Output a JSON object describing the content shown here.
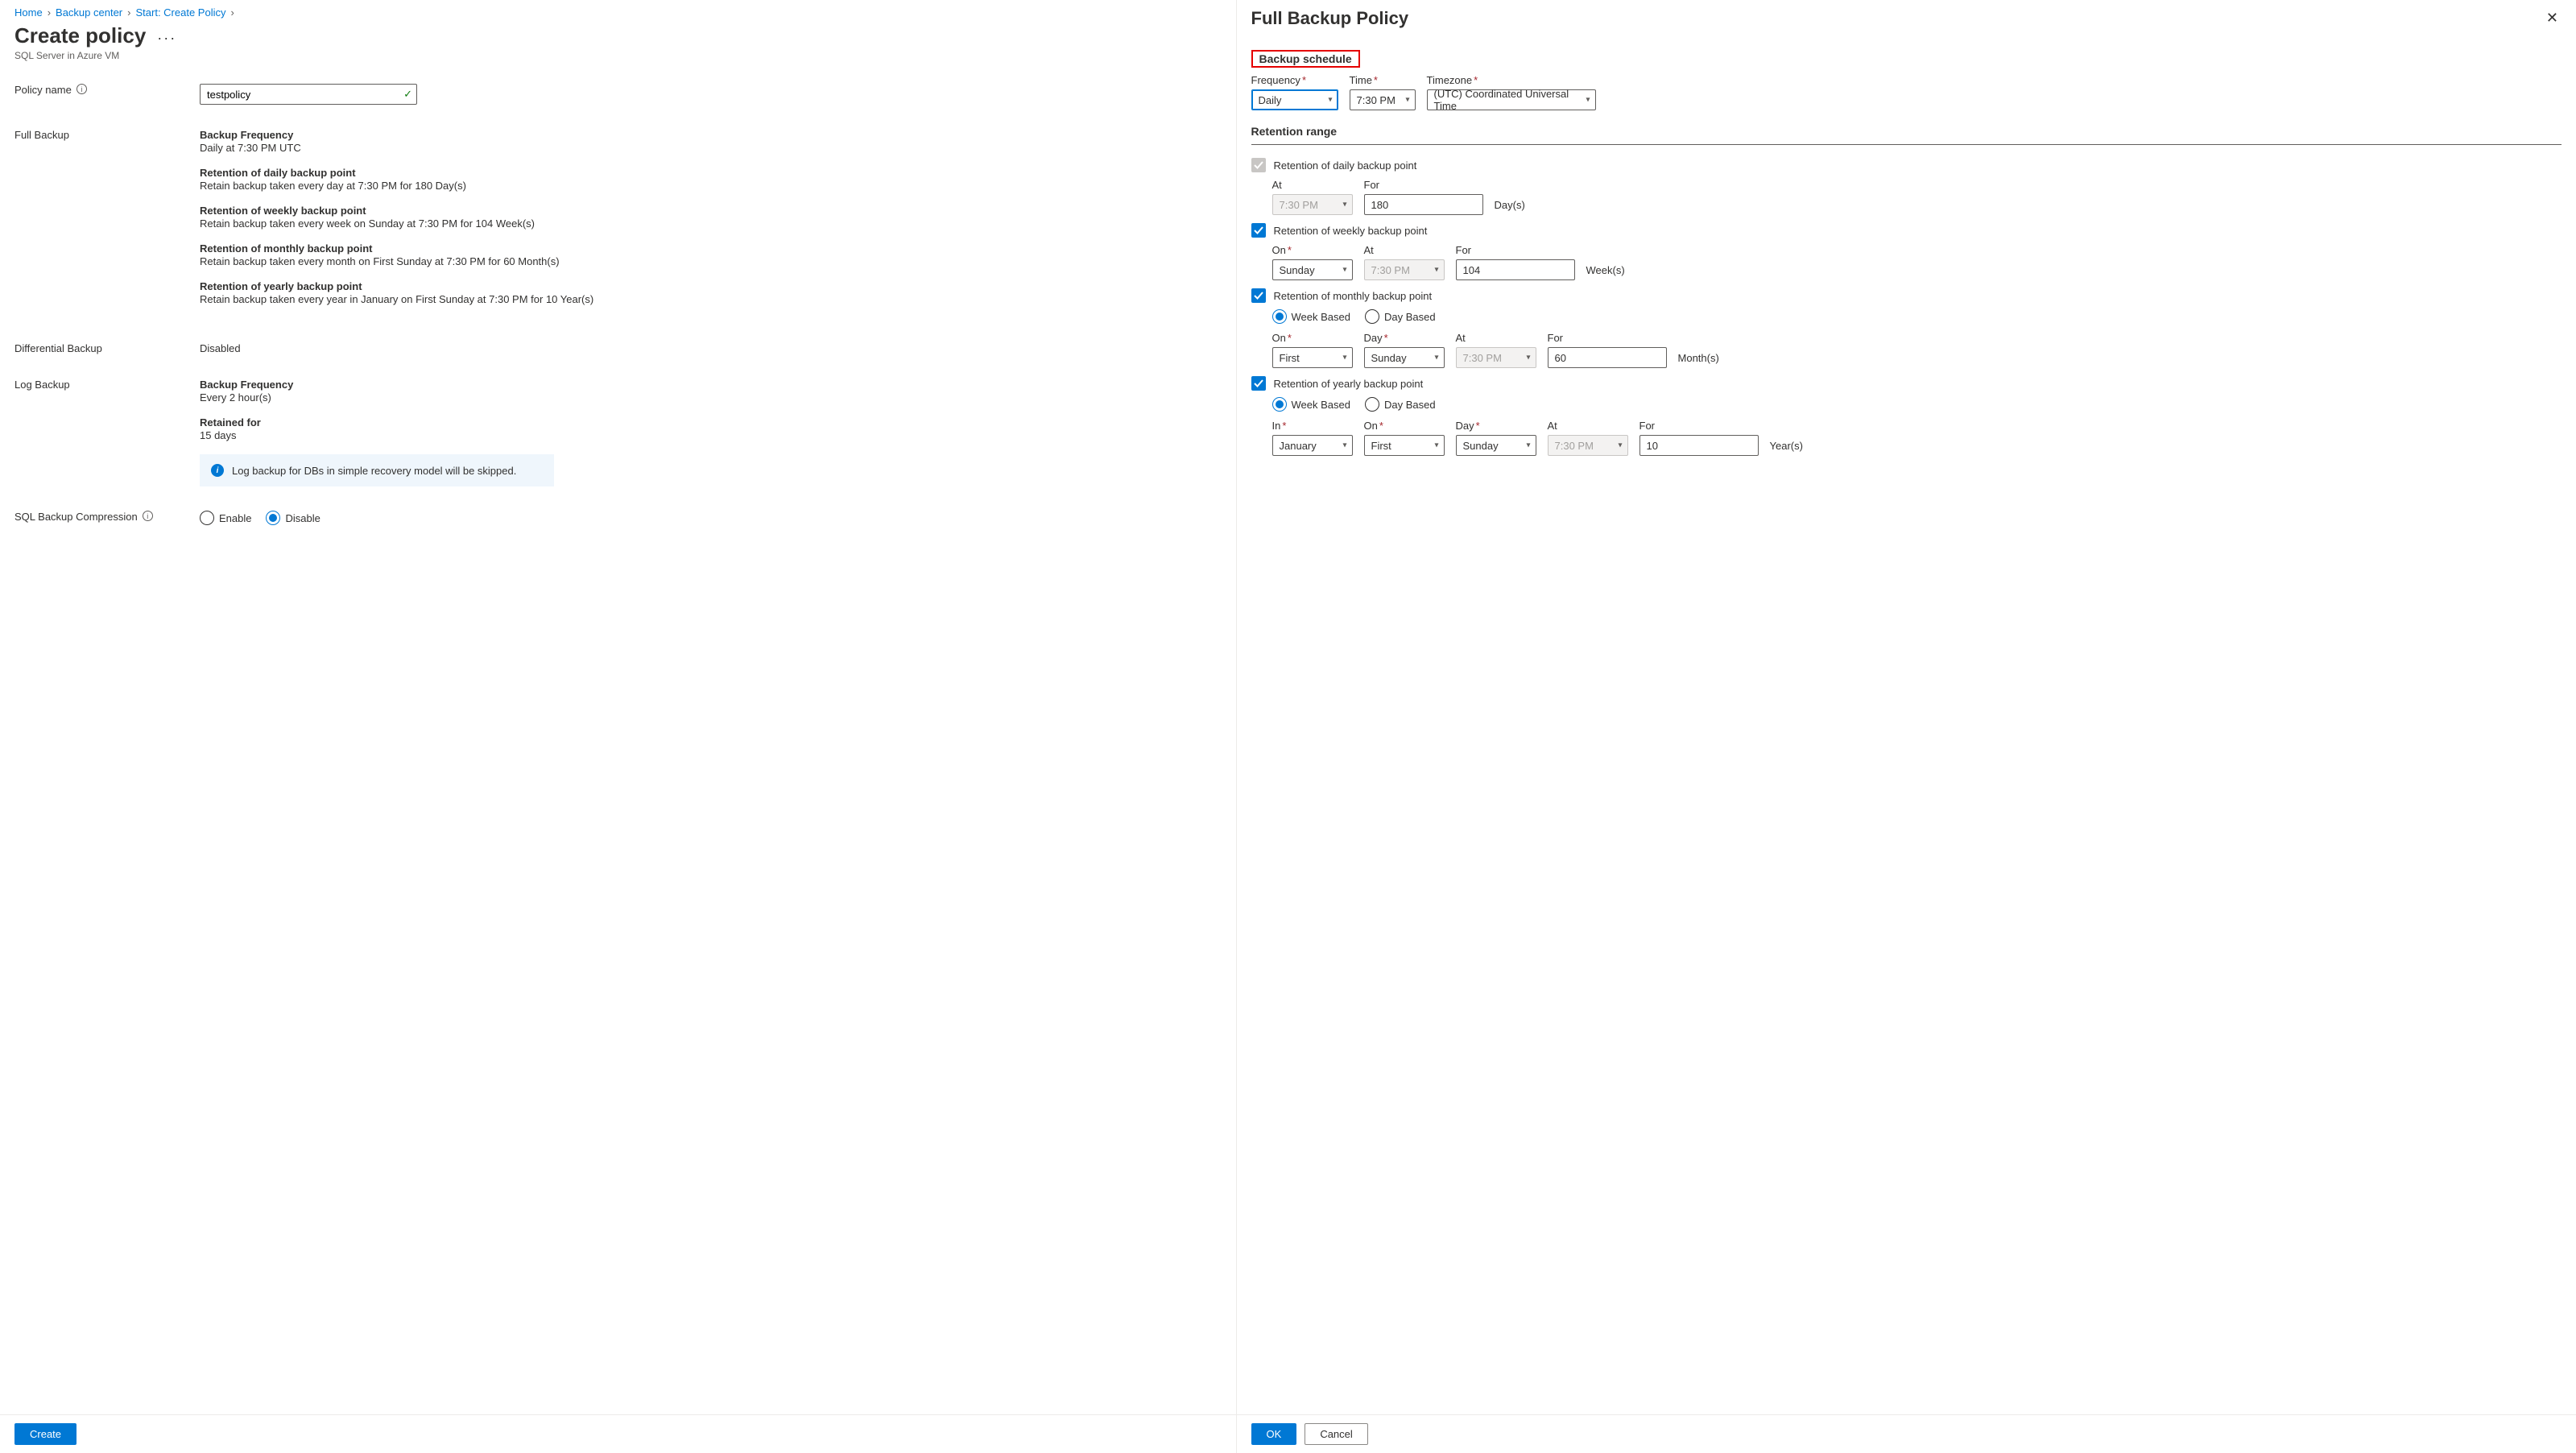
{
  "breadcrumb": [
    "Home",
    "Backup center",
    "Start: Create Policy"
  ],
  "left": {
    "title": "Create policy",
    "subtitle": "SQL Server in Azure VM",
    "policyNameLabel": "Policy name",
    "policyNameValue": "testpolicy",
    "fullBackupLabel": "Full Backup",
    "fullBackup": {
      "freqTitle": "Backup Frequency",
      "freqDesc": "Daily at 7:30 PM UTC",
      "dailyTitle": "Retention of daily backup point",
      "dailyDesc": "Retain backup taken every day at 7:30 PM for 180 Day(s)",
      "weeklyTitle": "Retention of weekly backup point",
      "weeklyDesc": "Retain backup taken every week on Sunday at 7:30 PM for 104 Week(s)",
      "monthlyTitle": "Retention of monthly backup point",
      "monthlyDesc": "Retain backup taken every month on First Sunday at 7:30 PM for 60 Month(s)",
      "yearlyTitle": "Retention of yearly backup point",
      "yearlyDesc": "Retain backup taken every year in January on First Sunday at 7:30 PM for 10 Year(s)"
    },
    "diffLabel": "Differential Backup",
    "diffValue": "Disabled",
    "logLabel": "Log Backup",
    "log": {
      "freqTitle": "Backup Frequency",
      "freqDesc": "Every 2 hour(s)",
      "retTitle": "Retained for",
      "retDesc": "15 days"
    },
    "banner": "Log backup for DBs in simple recovery model will be skipped.",
    "compressionLabel": "SQL Backup Compression",
    "compression": {
      "enable": "Enable",
      "disable": "Disable"
    },
    "createBtn": "Create"
  },
  "right": {
    "title": "Full Backup Policy",
    "scheduleHeading": "Backup schedule",
    "labels": {
      "frequency": "Frequency",
      "time": "Time",
      "timezone": "Timezone",
      "retentionRange": "Retention range",
      "at": "At",
      "for": "For",
      "on": "On",
      "day": "Day",
      "in": "In",
      "days": "Day(s)",
      "weeks": "Week(s)",
      "months": "Month(s)",
      "years": "Year(s)",
      "weekBased": "Week Based",
      "dayBased": "Day Based",
      "daily": "Retention of daily backup point",
      "weekly": "Retention of weekly backup point",
      "monthly": "Retention of monthly backup point",
      "yearly": "Retention of yearly backup point"
    },
    "values": {
      "frequency": "Daily",
      "time": "7:30 PM",
      "timezone": "(UTC) Coordinated Universal Time",
      "dailyAt": "7:30 PM",
      "dailyFor": "180",
      "weeklyOn": "Sunday",
      "weeklyAt": "7:30 PM",
      "weeklyFor": "104",
      "monthlyOn": "First",
      "monthlyDay": "Sunday",
      "monthlyAt": "7:30 PM",
      "monthlyFor": "60",
      "yearlyIn": "January",
      "yearlyOn": "First",
      "yearlyDay": "Sunday",
      "yearlyAt": "7:30 PM",
      "yearlyFor": "10"
    },
    "okBtn": "OK",
    "cancelBtn": "Cancel"
  }
}
